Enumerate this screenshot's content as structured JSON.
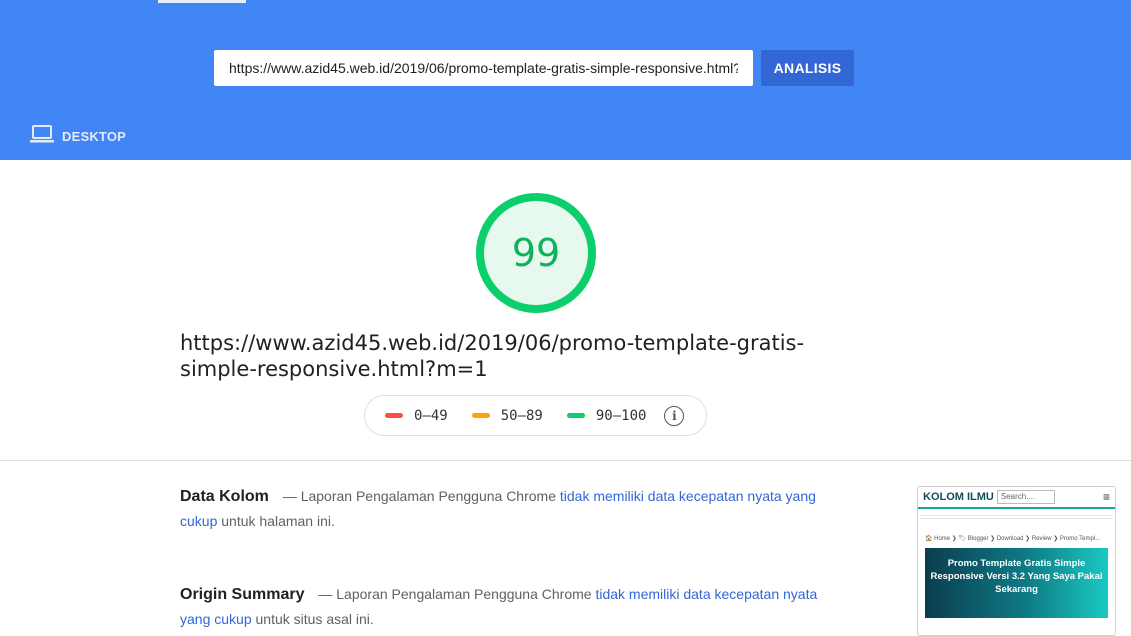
{
  "header": {
    "url_value": "https://www.azid45.web.id/2019/06/promo-template-gratis-simple-responsive.html?m=1",
    "analyze_label": "ANALISIS",
    "device_tab_label": "DESKTOP",
    "device_icon": "laptop-icon",
    "background_color": "#4285f4",
    "button_color": "#3367d6"
  },
  "score": {
    "value": "99",
    "fraction": 0.99,
    "color": "#0cce6b"
  },
  "page_url": "https://www.azid45.web.id/2019/06/promo-template-gratis-simple-responsive.html?m=1",
  "legend": {
    "items": [
      {
        "label": "0–49",
        "color": "#ff4e42"
      },
      {
        "label": "50–89",
        "color": "#ffa400"
      },
      {
        "label": "90–100",
        "color": "#0cce6b"
      }
    ],
    "info_icon": "info-icon"
  },
  "field_data": {
    "title": "Data Kolom",
    "dash": "—",
    "text_before": "Laporan Pengalaman Pengguna Chrome",
    "link": "tidak memiliki data kecepatan nyata yang cukup",
    "text_after": "untuk halaman ini."
  },
  "origin_summary": {
    "title": "Origin Summary",
    "dash": "—",
    "text_before": "Laporan Pengalaman Pengguna Chrome",
    "link": "tidak memiliki data kecepatan nyata yang cukup",
    "text_after": "untuk situs asal ini."
  },
  "thumbnail": {
    "brand": "KOLOM ILMU",
    "search_placeholder": "Search....",
    "breadcrumb": "🏠 Home  ❯  🏷 Blogger  ❯  Download  ❯  Review  ❯  Promo Templ...",
    "hero_title": "Promo Template Gratis Simple Responsive Versi 3.2 Yang Saya Pakai Sekarang"
  }
}
